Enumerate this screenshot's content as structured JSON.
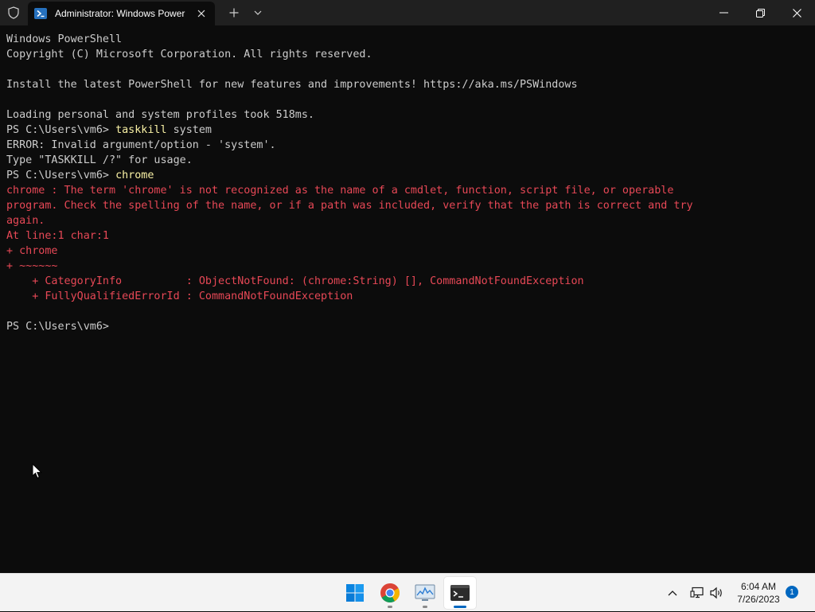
{
  "window": {
    "tab_title": "Administrator: Windows PowerShell",
    "icons": {
      "shield": "shield-icon",
      "tab": "powershell-icon",
      "close_tab": "close-icon",
      "new_tab": "plus-icon",
      "dropdown": "chevron-down-icon",
      "minimize": "minimize-icon",
      "maximize": "maximize-icon",
      "close": "close-icon"
    }
  },
  "console": {
    "colors": {
      "background": "#0c0c0c",
      "text": "#cccccc",
      "error": "#e74856",
      "command": "#f9f1a5"
    },
    "lines": {
      "l01": "Windows PowerShell",
      "l02": "Copyright (C) Microsoft Corporation. All rights reserved.",
      "l03": "",
      "l04": "Install the latest PowerShell for new features and improvements! https://aka.ms/PSWindows",
      "l05": "",
      "l06": "Loading personal and system profiles took 518ms.",
      "l07_prompt": "PS C:\\Users\\vm6> ",
      "l07_cmd": "taskkill",
      "l07_args": " system",
      "l08": "ERROR: Invalid argument/option - 'system'.",
      "l09": "Type \"TASKKILL /?\" for usage.",
      "l10_prompt": "PS C:\\Users\\vm6> ",
      "l10_cmd": "chrome",
      "l11": "chrome : The term 'chrome' is not recognized as the name of a cmdlet, function, script file, or operable",
      "l12": "program. Check the spelling of the name, or if a path was included, verify that the path is correct and try",
      "l13": "again.",
      "l14": "At line:1 char:1",
      "l15": "+ chrome",
      "l16": "+ ~~~~~~",
      "l17": "    + CategoryInfo          : ObjectNotFound: (chrome:String) [], CommandNotFoundException",
      "l18": "    + FullyQualifiedErrorId : CommandNotFoundException",
      "l19": "",
      "l20": "PS C:\\Users\\vm6>"
    }
  },
  "taskbar": {
    "apps": [
      "windows-start-icon",
      "chrome-icon",
      "performance-monitor-icon",
      "terminal-icon"
    ],
    "active_app": "terminal-icon",
    "tray_icons": [
      "chevron-up-icon",
      "network-icon",
      "volume-icon"
    ],
    "time": "6:04 AM",
    "date": "7/26/2023",
    "notification_count": "1",
    "accent": "#0067c0"
  }
}
